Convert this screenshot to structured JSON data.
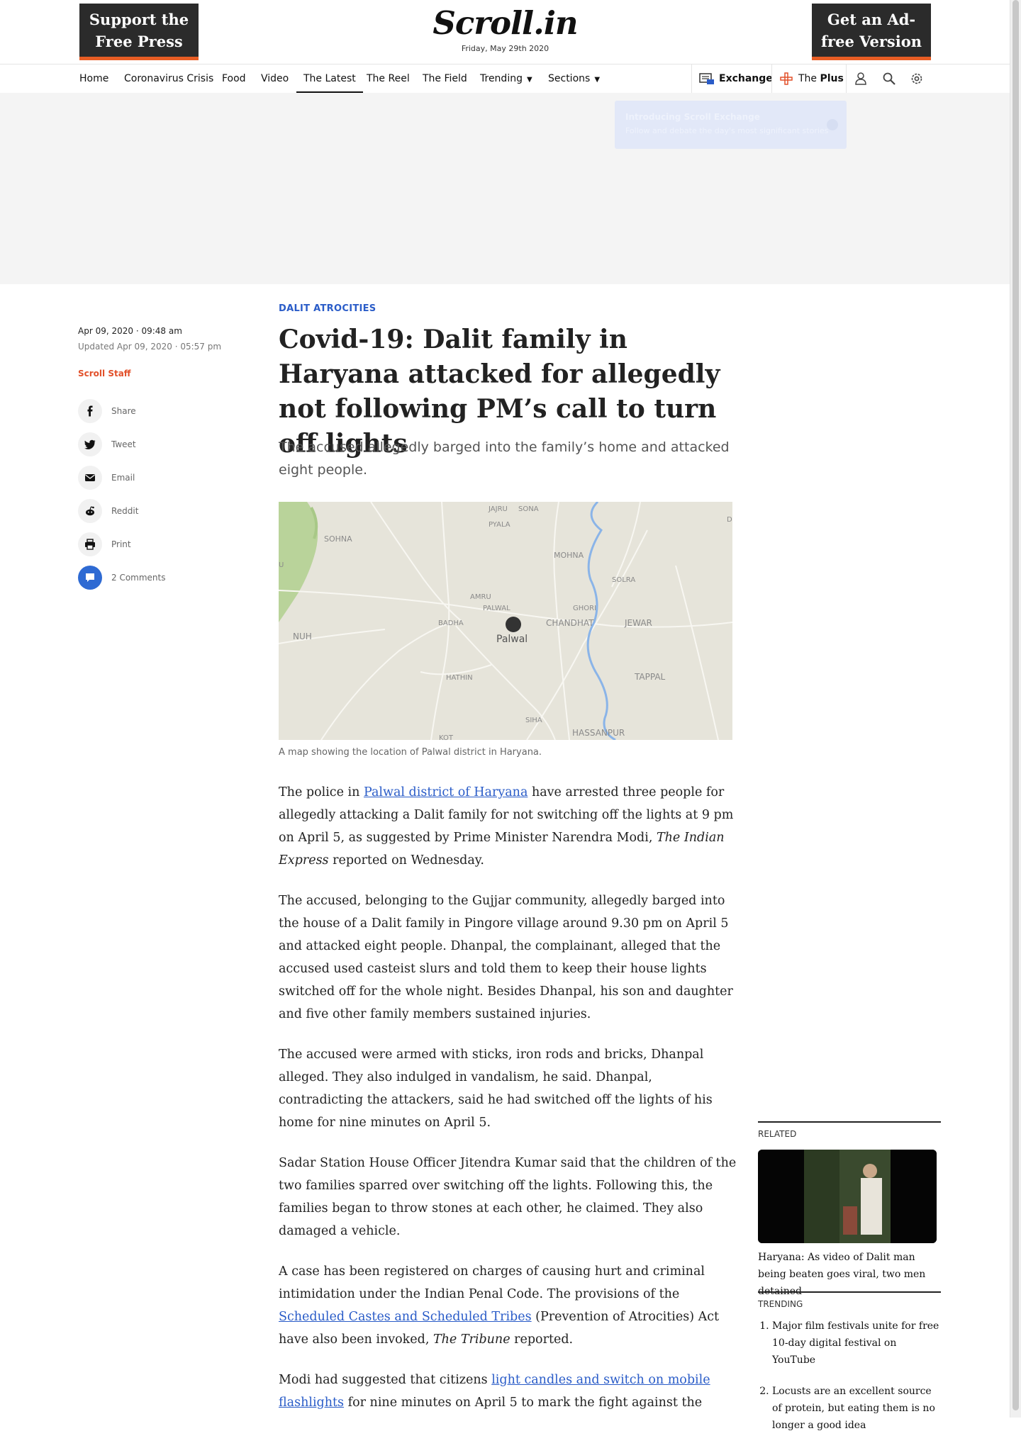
{
  "header": {
    "support_label": "Support the Free Press",
    "logo": "Scroll.in",
    "date": "Friday, May 29th 2020",
    "adfree_label": "Get an Ad-free Version"
  },
  "nav": {
    "items": [
      "Home",
      "Coronavirus Crisis",
      "Food",
      "Video",
      "The Latest",
      "The Reel",
      "The Field",
      "Trending",
      "Sections"
    ],
    "active": "The Latest",
    "exchange_label": "Exchange",
    "plus_the": "The",
    "plus_label": "Plus"
  },
  "tooltip": {
    "title": "Introducing Scroll Exchange",
    "text": "Follow and debate the day's most significant stories"
  },
  "meta": {
    "published": "Apr 09, 2020 · 09:48 am",
    "updated": "Updated Apr 09, 2020 · 05:57 pm",
    "author": "Scroll Staff",
    "share": {
      "share": "Share",
      "tweet": "Tweet",
      "email": "Email",
      "reddit": "Reddit",
      "print": "Print",
      "comments": "2 Comments"
    }
  },
  "article": {
    "kicker": "DALIT ATROCITIES",
    "title": "Covid-19: Dalit family in Haryana attacked for allegedly not following PM’s call to turn off lights",
    "subtitle": "The accused allegedly barged into the family’s home and attacked eight people.",
    "map_labels": {
      "jajru": "JAJRU",
      "sona": "SONA",
      "pyala": "PYALA",
      "sohna": "SOHNA",
      "mohna": "MOHNA",
      "solra": "SOLRA",
      "amru": "AMRU",
      "palwal_small": "PALWAL",
      "ghori": "GHORI",
      "badha": "BADHA",
      "chandhat": "CHANDHAT",
      "jewar": "JEWAR",
      "nuh": "NUH",
      "palwal": "Palwal",
      "hathin": "HATHIN",
      "tappal": "TAPPAL",
      "siha": "SIHA",
      "hassanpur": "HASSANPUR",
      "kot": "KOT",
      "edge_u": "U",
      "edge_d": "D"
    },
    "caption": "A map showing the location of Palwal district in Haryana.",
    "p1": {
      "a": "The police in ",
      "link": "Palwal district of Haryana",
      "b": " have arrested three people for allegedly attacking a Dalit family for not switching off the lights at 9 pm on April 5, as suggested by Prime Minister Narendra Modi, ",
      "em": "The Indian Express",
      "c": " reported on Wednesday."
    },
    "p2": "The accused, belonging to the Gujjar community, allegedly barged into the house of a Dalit family in Pingore village around 9.30 pm on April 5 and attacked eight people. Dhanpal, the complainant, alleged that the accused used casteist slurs and told them to keep their house lights switched off for the whole night. Besides Dhanpal, his son and daughter and five other family members sustained injuries.",
    "p3": "The accused were armed with sticks, iron rods and bricks, Dhanpal alleged. They also indulged in vandalism, he said. Dhanpal, contradicting the attackers, said he had switched off the lights of his home for nine minutes on April 5.",
    "p4": "Sadar Station House Officer Jitendra Kumar said that the children of the two families sparred over switching off the lights. Following this, the families began to throw stones at each other, he claimed. They also damaged a vehicle.",
    "p5": {
      "a": "A case has been registered on charges of causing hurt and criminal intimidation under the Indian Penal Code. The provisions of the ",
      "link": "Scheduled Castes and Scheduled Tribes",
      "b": " (Prevention of Atrocities) Act have also been invoked, ",
      "em": "The Tribune",
      "c": " reported."
    },
    "p6": {
      "a": "Modi had suggested that citizens ",
      "link": "light candles and switch on mobile flashlights",
      "b": " for nine minutes on April 5 to mark the fight against the"
    }
  },
  "sidebar": {
    "related_head": "RELATED",
    "related_title": "Haryana: As video of Dalit man being beaten goes viral, two men detained",
    "trending_head": "TRENDING",
    "trending": [
      "Major film festivals unite for free 10-day digital festival on YouTube",
      "Locusts are an excellent source of protein, but eating them is no longer a good idea"
    ]
  },
  "colors": {
    "accent_blue": "#2a5cc8",
    "author_orange": "#e2502a",
    "promo_border": "#e85d24"
  }
}
